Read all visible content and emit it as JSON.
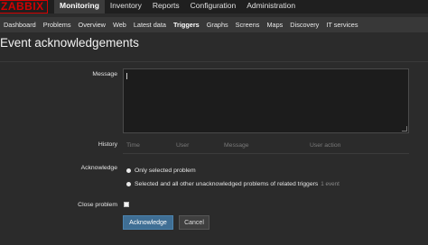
{
  "app": {
    "logo": "ZABBIX"
  },
  "top_menu": [
    {
      "label": "Monitoring",
      "active": true
    },
    {
      "label": "Inventory",
      "active": false
    },
    {
      "label": "Reports",
      "active": false
    },
    {
      "label": "Configuration",
      "active": false
    },
    {
      "label": "Administration",
      "active": false
    }
  ],
  "sub_menu": [
    {
      "label": "Dashboard",
      "active": false
    },
    {
      "label": "Problems",
      "active": false
    },
    {
      "label": "Overview",
      "active": false
    },
    {
      "label": "Web",
      "active": false
    },
    {
      "label": "Latest data",
      "active": false
    },
    {
      "label": "Triggers",
      "active": true
    },
    {
      "label": "Graphs",
      "active": false
    },
    {
      "label": "Screens",
      "active": false
    },
    {
      "label": "Maps",
      "active": false
    },
    {
      "label": "Discovery",
      "active": false
    },
    {
      "label": "IT services",
      "active": false
    }
  ],
  "page": {
    "title": "Event acknowledgements"
  },
  "form": {
    "message_label": "Message",
    "message_value": "",
    "history_label": "History",
    "history_columns": [
      "Time",
      "User",
      "Message",
      "User action"
    ],
    "acknowledge_label": "Acknowledge",
    "option_only_selected": "Only selected problem",
    "option_all_related": "Selected and all other unacknowledged problems of related triggers",
    "option_all_related_count": "1 event",
    "selected_option": "option_all_related",
    "close_problem_label": "Close problem",
    "close_problem_checked": false
  },
  "buttons": {
    "acknowledge": "Acknowledge",
    "cancel": "Cancel"
  },
  "colors": {
    "logo": "#d40000",
    "primary_button": "#3f6e94",
    "background": "#2b2b2b"
  }
}
